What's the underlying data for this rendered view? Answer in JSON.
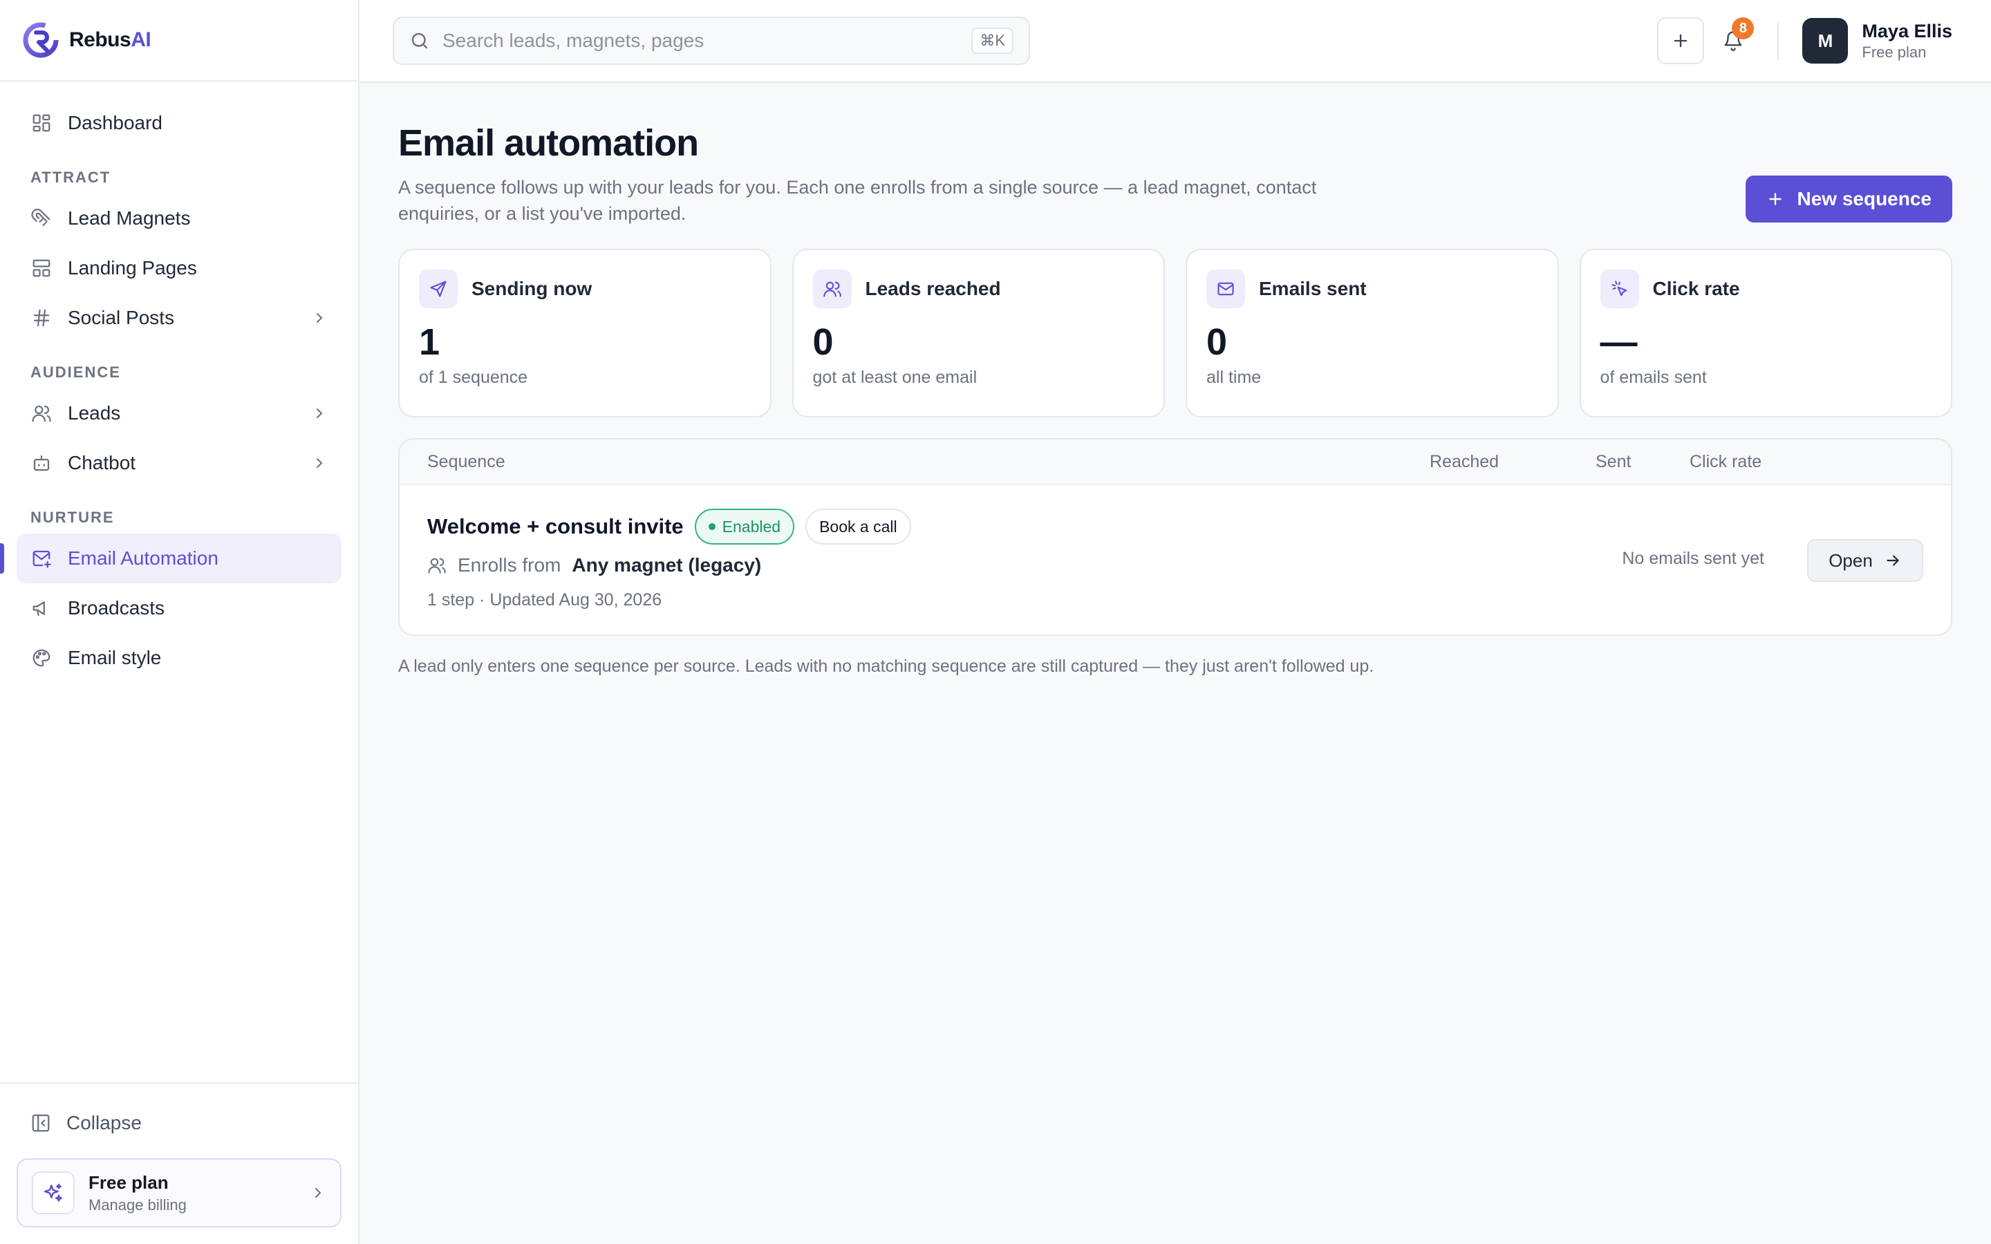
{
  "brand": {
    "name": "Rebus",
    "name_accent": "AI"
  },
  "sidebar": {
    "dashboard": {
      "label": "Dashboard",
      "icon": "dashboard-icon"
    },
    "sections": {
      "attract": "ATTRACT",
      "audience": "AUDIENCE",
      "nurture": "NURTURE"
    },
    "items": {
      "lead_magnets": {
        "label": "Lead Magnets",
        "icon": "magnet-icon"
      },
      "landing_pages": {
        "label": "Landing Pages",
        "icon": "layout-icon"
      },
      "social_posts": {
        "label": "Social Posts",
        "icon": "hash-icon"
      },
      "leads": {
        "label": "Leads",
        "icon": "users-icon"
      },
      "chatbot": {
        "label": "Chatbot",
        "icon": "bot-icon"
      },
      "email_automation": {
        "label": "Email Automation",
        "icon": "mail-plus-icon",
        "active": true
      },
      "broadcasts": {
        "label": "Broadcasts",
        "icon": "megaphone-icon"
      },
      "email_style": {
        "label": "Email style",
        "icon": "palette-icon"
      }
    },
    "collapse_label": "Collapse",
    "plan": {
      "title": "Free plan",
      "subtitle": "Manage billing"
    }
  },
  "topbar": {
    "search_placeholder": "Search leads, magnets, pages",
    "shortcut": "⌘K",
    "notification_count": "8",
    "user": {
      "initial": "M",
      "name": "Maya Ellis",
      "plan": "Free plan"
    }
  },
  "page": {
    "title": "Email automation",
    "description": "A sequence follows up with your leads for you. Each one enrolls from a single source — a lead magnet, contact enquiries, or a list you've imported.",
    "new_button": "New sequence"
  },
  "stats": [
    {
      "label": "Sending now",
      "value": "1",
      "sub": "of 1 sequence",
      "icon": "send-icon"
    },
    {
      "label": "Leads reached",
      "value": "0",
      "sub": "got at least one email",
      "icon": "users-icon"
    },
    {
      "label": "Emails sent",
      "value": "0",
      "sub": "all time",
      "icon": "mail-icon"
    },
    {
      "label": "Click rate",
      "value": "—",
      "sub": "of emails sent",
      "icon": "cursor-click-icon"
    }
  ],
  "table": {
    "headers": {
      "sequence": "Sequence",
      "reached": "Reached",
      "sent": "Sent",
      "click_rate": "Click rate"
    },
    "rows": [
      {
        "name": "Welcome + consult invite",
        "status": "Enabled",
        "tag": "Book a call",
        "enrolls_prefix": "Enrolls from",
        "source": "Any magnet (legacy)",
        "meta": "1 step · Updated Aug 30, 2026",
        "summary": "No emails sent yet",
        "action": "Open"
      }
    ]
  },
  "footnote": "A lead only enters one sequence per source. Leads with no matching sequence are still captured — they just aren't followed up.",
  "colors": {
    "accent": "#5b4fd6",
    "enabled": "#1a9463",
    "badge": "#f07a2a"
  }
}
